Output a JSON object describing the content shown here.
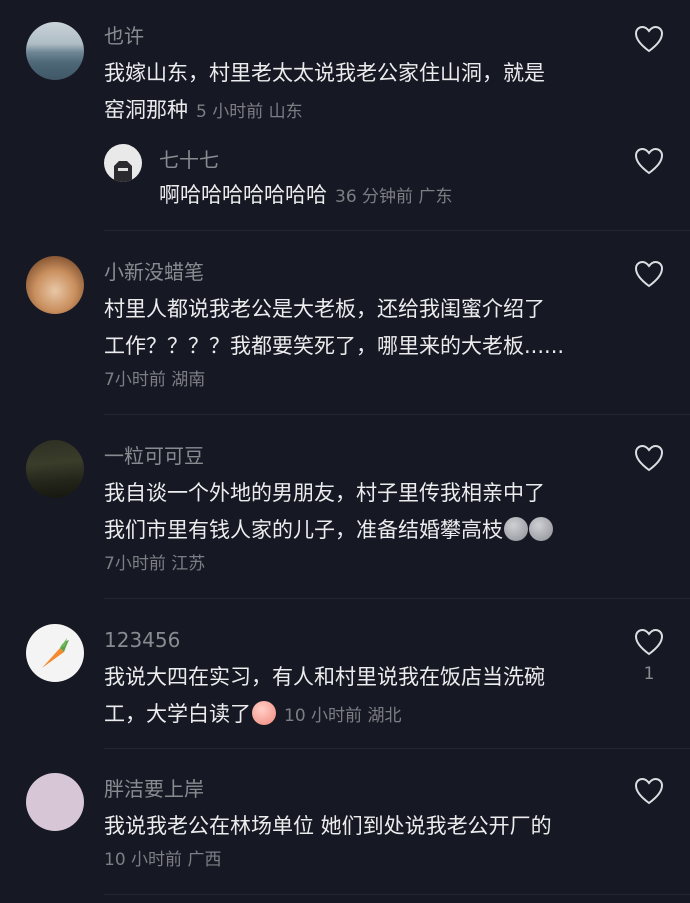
{
  "comments": [
    {
      "username": "也许",
      "lines": [
        "我嫁山东，村里老太太说我老公家住山洞，就是",
        "窑洞那种"
      ],
      "meta": "5 小时前 山东"
    },
    {
      "username": "七十七",
      "lines": [
        "啊哈哈哈哈哈哈哈"
      ],
      "meta": "36 分钟前 广东"
    },
    {
      "username": "小新没蜡笔",
      "lines": [
        "村里人都说我老公是大老板，还给我闺蜜介绍了",
        "工作？？？？我都要笑死了，哪里来的大老板......"
      ],
      "meta": "7小时前 湖南"
    },
    {
      "username": "一粒可可豆",
      "lines": [
        "我自谈一个外地的男朋友，村子里传我相亲中了",
        "我们市里有钱人家的儿子，准备结婚攀高枝"
      ],
      "meta": "7小时前 江苏"
    },
    {
      "username": "123456",
      "lines": [
        "我说大四在实习，有人和村里说我在饭店当洗碗",
        "工，大学白读了"
      ],
      "meta": "10 小时前 湖北",
      "likes": "1"
    },
    {
      "username": "胖洁要上岸",
      "lines": [
        "我说我老公在林场单位  她们到处说我老公开厂的"
      ],
      "meta": "10 小时前 广西"
    }
  ],
  "colors": {
    "background": "#161823",
    "text": "#ececee",
    "secondary": "#8a8b91"
  },
  "icons": {
    "like": "heart-outline-icon",
    "avatar_badge": "shirt-icon",
    "avatar_carrot": "carrot-icon"
  }
}
